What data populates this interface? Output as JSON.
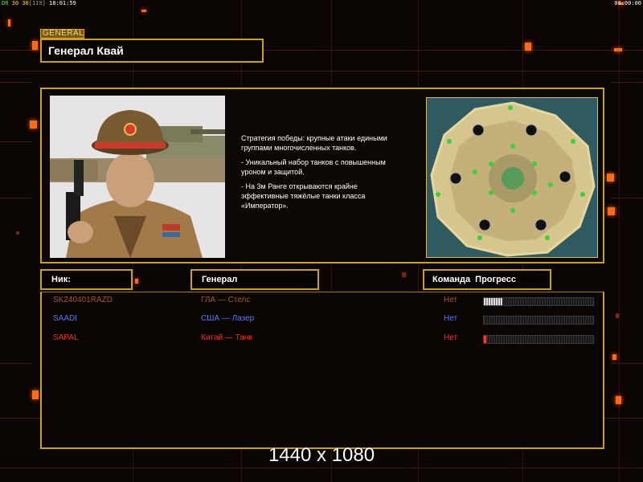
{
  "status_bar": {
    "seg1": "DR",
    "seg2": "30",
    "seg3": "30",
    "seg4": "[119]",
    "clock": "18:01:59",
    "timer": "00:00:00"
  },
  "general": {
    "tag": "GENERAL",
    "name": "Генерал Квай",
    "description": [
      "Стратегия победы: крупные атаки едиными\n группами многочисленных танков.",
      "- Уникальный набор танков с повышенным\n уроном и защитой.",
      "- На 3м Ранге открываются крайне\n эффективные тяжёлые танки класса\n «Император»."
    ],
    "portrait": "general-portrait",
    "map": {
      "start_positions": [
        "1",
        "2",
        "3"
      ]
    }
  },
  "columns": {
    "nick": "Ник:",
    "general": "Генерал",
    "team": "Команда",
    "progress": "Прогресс"
  },
  "players": [
    {
      "nick": "SK240401RAZD",
      "general": "ГЛА — Стелс",
      "team": "Нет",
      "progress": 0.17,
      "color": "#a8562f"
    },
    {
      "nick": "SAADI",
      "general": "США — Лазер",
      "team": "Нет",
      "progress": 0.0,
      "color": "#4a7aff"
    },
    {
      "nick": "SAPAL",
      "general": "Китай — Танк",
      "team": "Нет",
      "progress": 0.02,
      "color": "#ff2a1a"
    }
  ],
  "watermark": "1440 x 1080",
  "colors": {
    "frame": "#c9a02a",
    "led": "#ff6a1a",
    "background": "#0b0503"
  }
}
